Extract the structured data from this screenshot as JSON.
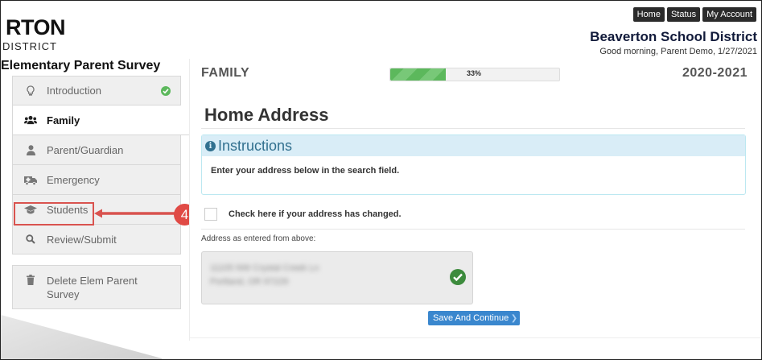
{
  "header": {
    "logo_main": "RTON",
    "logo_sub": "DISTRICT",
    "nav": [
      "Home",
      "Status",
      "My Account"
    ],
    "district_name": "Beaverton School District",
    "greeting": "Good morning, Parent Demo, 1/27/2021"
  },
  "sidebar": {
    "survey_title": "Elementary Parent Survey",
    "items": [
      {
        "label": "Introduction",
        "icon": "lightbulb-icon",
        "completed": true
      },
      {
        "label": "Family",
        "icon": "users-icon",
        "active": true
      },
      {
        "label": "Parent/Guardian",
        "icon": "user-icon"
      },
      {
        "label": "Emergency",
        "icon": "ambulance-icon"
      },
      {
        "label": "Students",
        "icon": "graduation-cap-icon"
      },
      {
        "label": "Review/Submit",
        "icon": "search-icon"
      }
    ],
    "delete_label": "Delete Elem Parent Survey"
  },
  "annotation": {
    "step": "4",
    "color": "#d9534f"
  },
  "main": {
    "section": "FAMILY",
    "progress_label": "33%",
    "progress_value": 0.33,
    "school_year": "2020-2021",
    "page_title": "Home Address",
    "instructions_title": "Instructions",
    "instructions_text": "Enter your address below in the search field.",
    "change_label": "Check here if your address has changed.",
    "address_label": "Address as entered from above:",
    "address_lines": [
      "11105 NW Crystal Creek Ln",
      "Portland, OR 97229"
    ],
    "save_label": "Save And Continue"
  },
  "colors": {
    "accent": "#3a87ce",
    "success": "#5cb85c",
    "info": "#31708f",
    "annotation": "#d9534f"
  }
}
